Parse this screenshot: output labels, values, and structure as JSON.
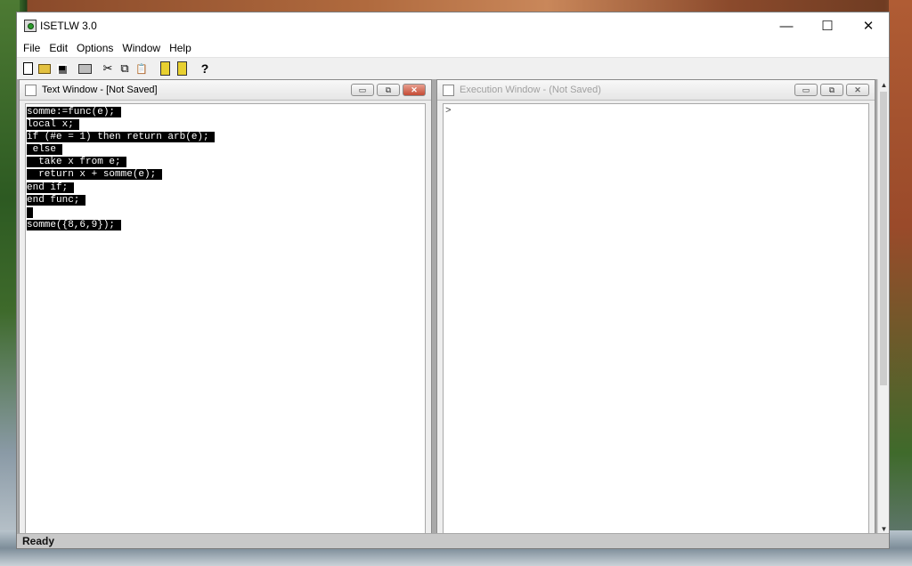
{
  "app": {
    "title": "ISETLW 3.0",
    "window_controls": {
      "minimize": "—",
      "maximize": "☐",
      "close": "✕"
    }
  },
  "menu": [
    "File",
    "Edit",
    "Options",
    "Window",
    "Help"
  ],
  "toolbar": {
    "icons": [
      "new-document-icon",
      "open-folder-icon",
      "save-disk-icon",
      "print-icon",
      "cut-scissors-icon",
      "copy-icon",
      "paste-icon",
      "run-light-icon",
      "stop-light-icon",
      "help-icon"
    ],
    "cut_glyph": "✂",
    "copy_glyph": "⧉",
    "paste_glyph": "📋",
    "help_glyph": "?"
  },
  "text_window": {
    "title": "Text Window - [Not Saved]",
    "lines": [
      "somme:=func(e); ",
      "local x; ",
      "if (#e = 1) then return arb(e); ",
      " else ",
      "  take x from e; ",
      "  return x + somme(e); ",
      "end if; ",
      "end func; ",
      " ",
      "somme({8,6,9}); "
    ]
  },
  "execution_window": {
    "title": "Execution Window - (Not Saved)",
    "prompt": ">"
  },
  "child_controls": {
    "minimize": "▭",
    "restore": "⧉",
    "close": "✕"
  },
  "status": "Ready"
}
